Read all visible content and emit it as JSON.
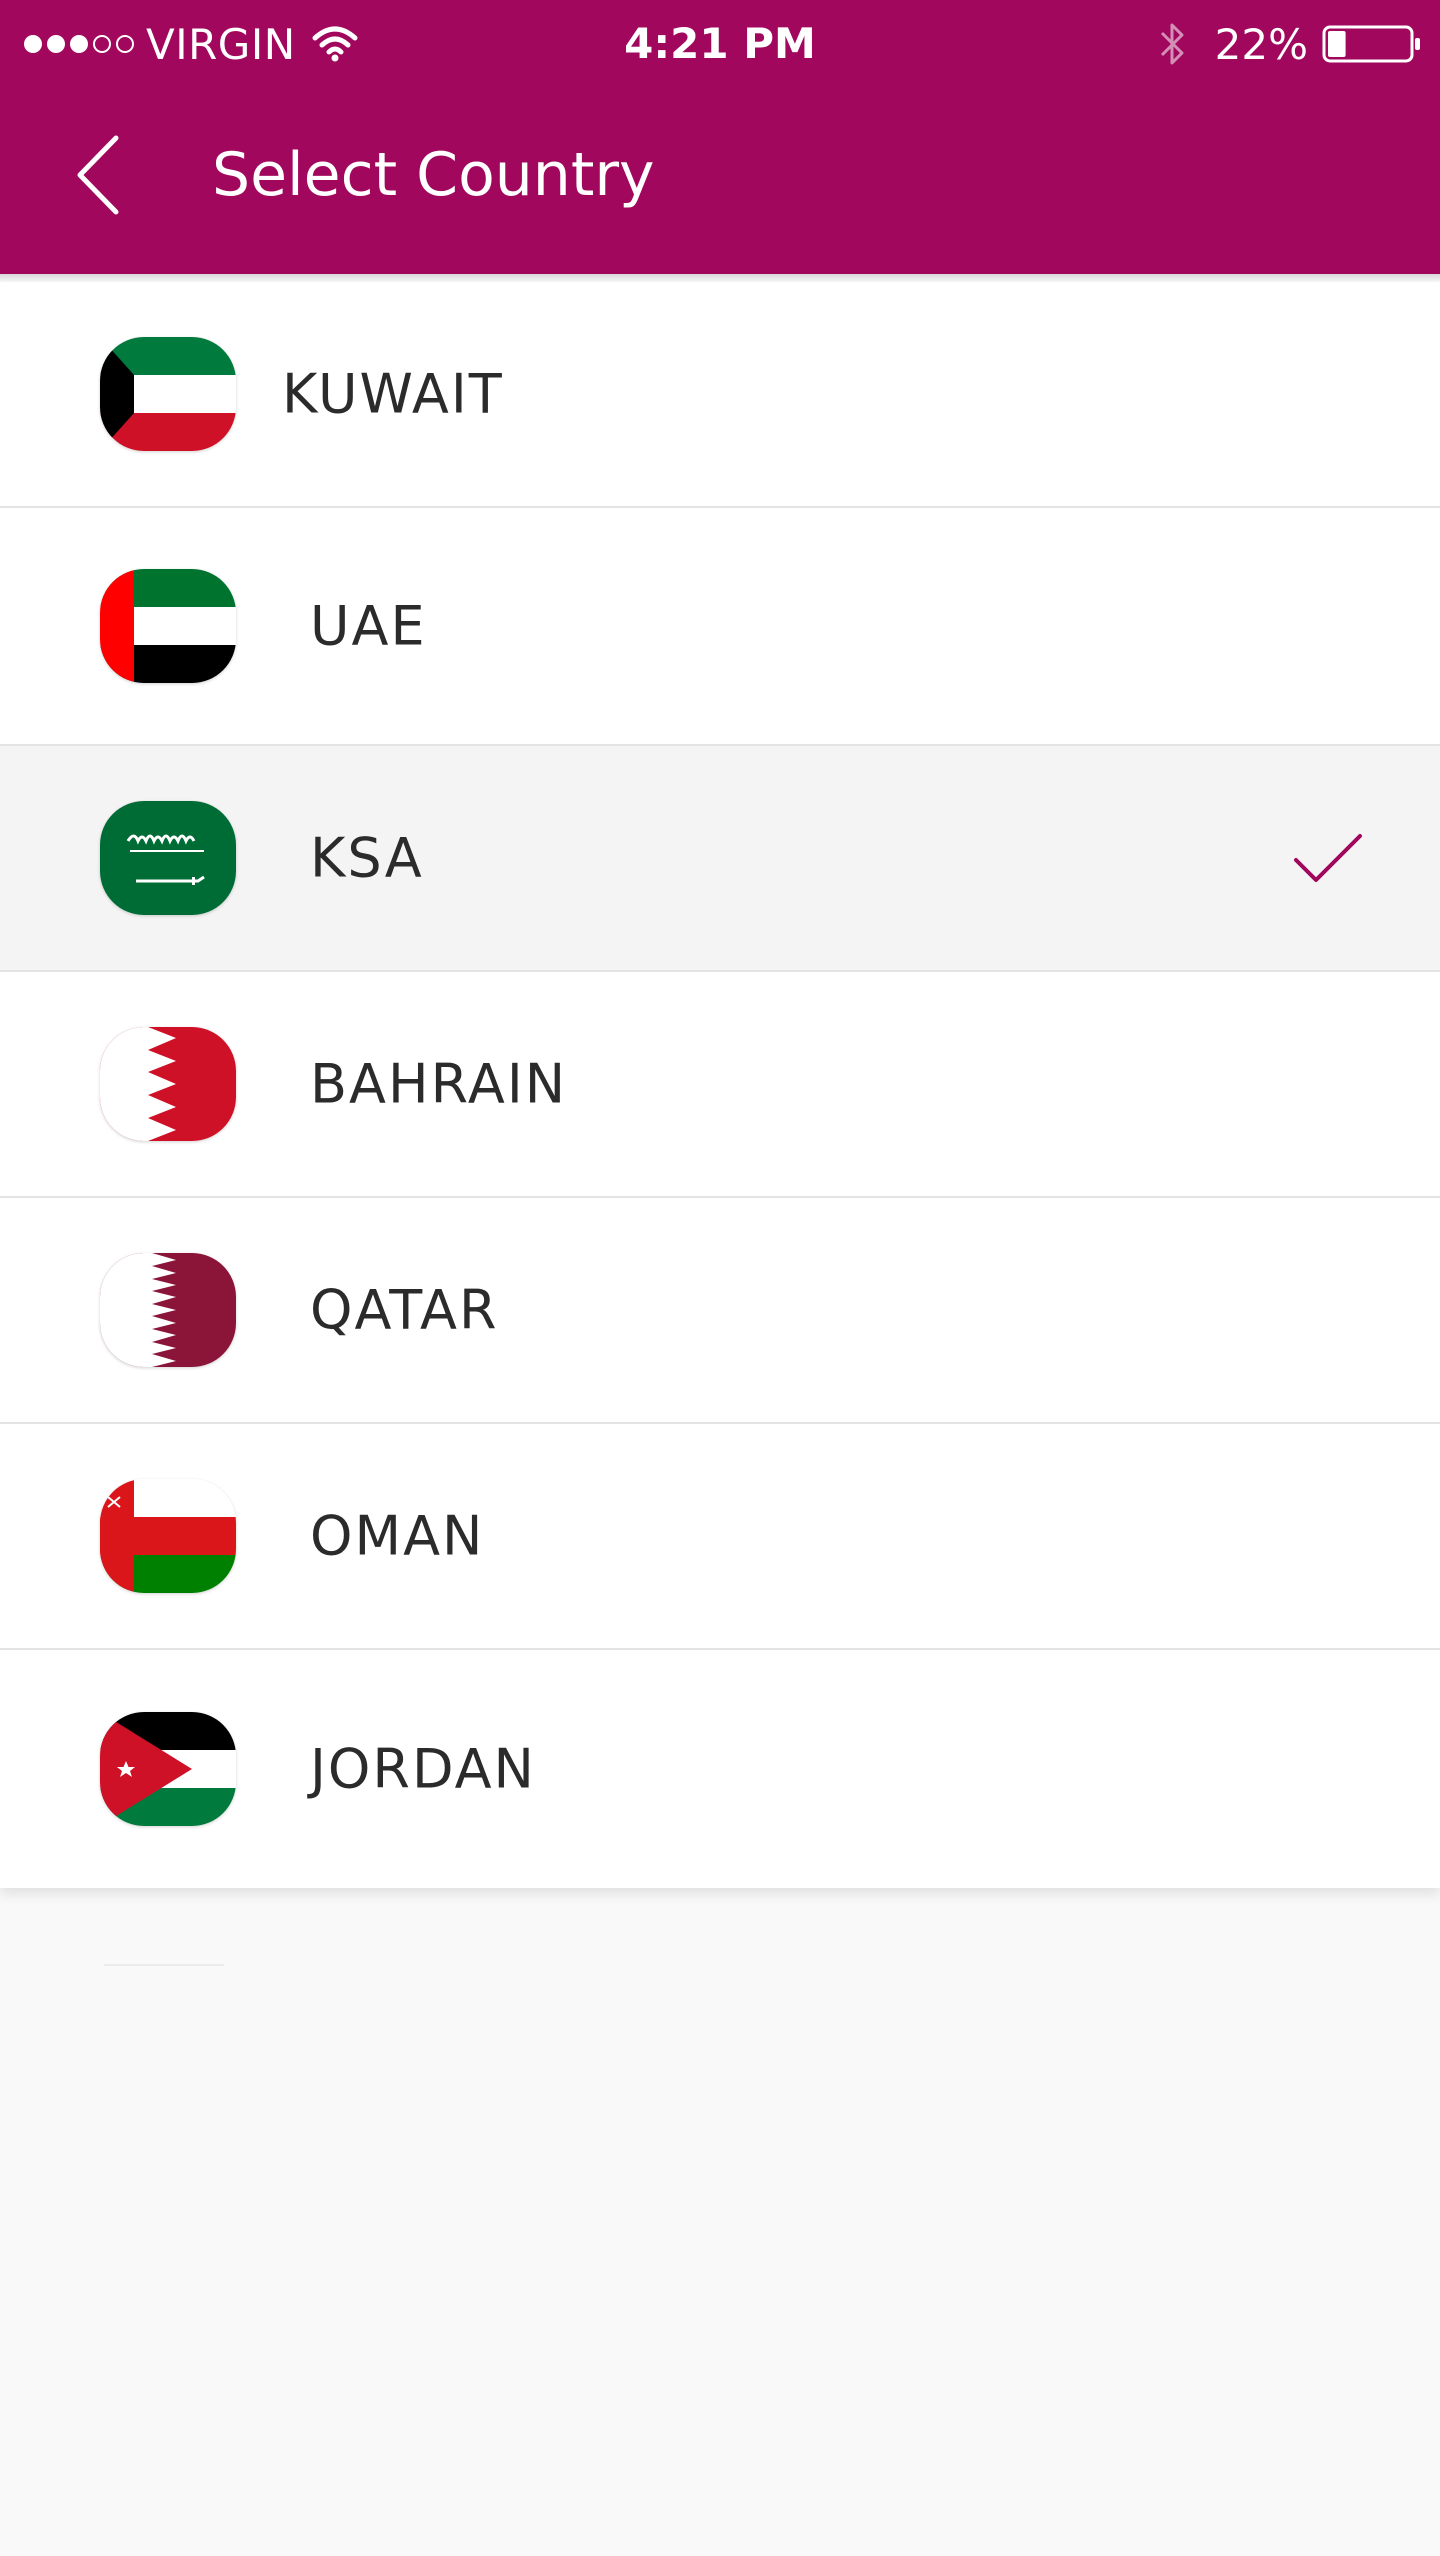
{
  "status_bar": {
    "carrier": "VIRGIN",
    "time": "4:21 PM",
    "battery": "22%",
    "signal_filled": 3,
    "signal_total": 5,
    "battery_level": 0.22
  },
  "header": {
    "title": "Select Country",
    "back_icon": "chevron-left-icon",
    "background_color": "#a0075d"
  },
  "countries": [
    {
      "name": "KUWAIT",
      "flag_icon": "kuwait-flag-icon",
      "selected": false
    },
    {
      "name": "UAE",
      "flag_icon": "uae-flag-icon",
      "selected": false
    },
    {
      "name": "KSA",
      "flag_icon": "ksa-flag-icon",
      "selected": true
    },
    {
      "name": "BAHRAIN",
      "flag_icon": "bahrain-flag-icon",
      "selected": false
    },
    {
      "name": "QATAR",
      "flag_icon": "qatar-flag-icon",
      "selected": false
    },
    {
      "name": "OMAN",
      "flag_icon": "oman-flag-icon",
      "selected": false
    },
    {
      "name": "JORDAN",
      "flag_icon": "jordan-flag-icon",
      "selected": false
    }
  ],
  "colors": {
    "accent": "#a0075d",
    "check": "#a0075d",
    "selected_row": "#f4f4f4",
    "text": "#2b2b2b"
  }
}
